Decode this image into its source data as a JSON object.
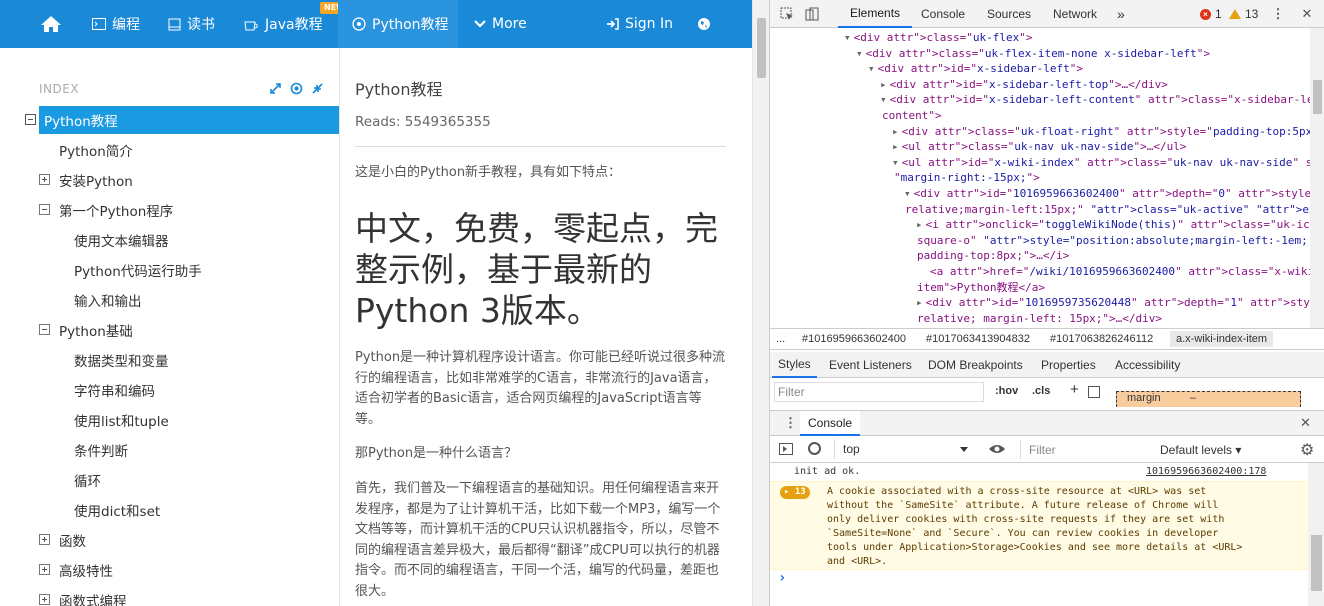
{
  "site": {
    "nav": [
      {
        "label": "",
        "icon": "home-icon"
      },
      {
        "label": "编程",
        "icon": "terminal-icon"
      },
      {
        "label": "读书",
        "icon": "book-icon"
      },
      {
        "label": "Java教程",
        "icon": "coffee-icon",
        "badge": "NEW"
      },
      {
        "label": "Python教程",
        "icon": "python-icon",
        "active": true
      },
      {
        "label": "More",
        "icon": "chevron-down-icon"
      },
      {
        "label": "Sign In",
        "icon": "signin-icon"
      },
      {
        "label": "",
        "icon": "globe-icon"
      }
    ],
    "sidebar": {
      "index_label": "INDEX",
      "items": [
        {
          "label": "Python教程",
          "active": true,
          "toggle": "minus"
        },
        {
          "label": "Python简介",
          "toggle": "none"
        },
        {
          "label": "安装Python",
          "toggle": "plus"
        },
        {
          "label": "第一个Python程序",
          "toggle": "minus"
        },
        {
          "label": "使用文本编辑器",
          "toggle": "none"
        },
        {
          "label": "Python代码运行助手",
          "toggle": "none"
        },
        {
          "label": "输入和输出",
          "toggle": "none"
        },
        {
          "label": "Python基础",
          "toggle": "minus"
        },
        {
          "label": "数据类型和变量",
          "toggle": "none"
        },
        {
          "label": "字符串和编码",
          "toggle": "none"
        },
        {
          "label": "使用list和tuple",
          "toggle": "none"
        },
        {
          "label": "条件判断",
          "toggle": "none"
        },
        {
          "label": "循环",
          "toggle": "none"
        },
        {
          "label": "使用dict和set",
          "toggle": "none"
        },
        {
          "label": "函数",
          "toggle": "plus"
        },
        {
          "label": "高级特性",
          "toggle": "plus"
        },
        {
          "label": "函数式编程",
          "toggle": "plus"
        }
      ]
    },
    "content": {
      "title": "Python教程",
      "reads": "Reads: 5549365355",
      "intro": "这是小白的Python新手教程，具有如下特点：",
      "headline": "中文，免费，零起点，完整示例，基于最新的Python 3版本。",
      "para1": "Python是一种计算机程序设计语言。你可能已经听说过很多种流行的编程语言，比如非常难学的C语言，非常流行的Java语言，适合初学者的Basic语言，适合网页编程的JavaScript语言等等。",
      "para2": "那Python是一种什么语言？",
      "para3": "首先，我们普及一下编程语言的基础知识。用任何编程语言来开发程序，都是为了让计算机干活，比如下载一个MP3，编写一个文档等等，而计算机干活的CPU只认识机器指令，所以，尽管不同的编程语言差异极大，最后都得“翻译”成CPU可以执行的机器指令。而不同的编程语言，干同一个活，编写的代码量，差距也很大。"
    }
  },
  "devtools": {
    "tabs": [
      "Elements",
      "Console",
      "Sources",
      "Network"
    ],
    "more_tabs": "»",
    "error_count": "1",
    "warning_count": "13",
    "elements_lines": [
      {
        "indent": 0,
        "arrow": "▾",
        "html": "<div class=\"uk-flex\">"
      },
      {
        "indent": 1,
        "arrow": "▾",
        "html": "<div class=\"uk-flex-item-none x-sidebar-left\">"
      },
      {
        "indent": 2,
        "arrow": "▾",
        "html": "<div id=\"x-sidebar-left\">"
      },
      {
        "indent": 3,
        "arrow": "▸",
        "html": "<div id=\"x-sidebar-left-top\">…</div>"
      },
      {
        "indent": 3,
        "arrow": "▾",
        "html": "<div id=\"x-sidebar-left-content\" class=\"x-sidebar-left-"
      },
      {
        "indent": 3,
        "arrow": "",
        "html": "content\">"
      },
      {
        "indent": 4,
        "arrow": "▸",
        "html": "<div class=\"uk-float-right\" style=\"padding-top:5px\">…</div>"
      },
      {
        "indent": 4,
        "arrow": "▸",
        "html": "<ul class=\"uk-nav uk-nav-side\">…</ul>"
      },
      {
        "indent": 4,
        "arrow": "▾",
        "html": "<ul id=\"x-wiki-index\" class=\"uk-nav uk-nav-side\" style="
      },
      {
        "indent": 4,
        "arrow": "",
        "html": "\"margin-right:-15px;\">"
      },
      {
        "indent": 5,
        "arrow": "▾",
        "html": "<div id=\"1016959663602400\" depth=\"0\" style=\"position:"
      },
      {
        "indent": 5,
        "arrow": "",
        "html": "relative;margin-left:15px;\" class=\"uk-active\" expand=\"true\">"
      },
      {
        "indent": 6,
        "arrow": "▸",
        "html": "<i onclick=\"toggleWikiNode(this)\" class=\"uk-icon-minus-"
      },
      {
        "indent": 6,
        "arrow": "",
        "html": "square-o\" style=\"position:absolute;margin-left:-1em;"
      },
      {
        "indent": 6,
        "arrow": "",
        "html": "padding-top:8px;\">…</i>"
      },
      {
        "indent": 6,
        "arrow": "",
        "html": "<a href=\"/wiki/1016959663602400\" class=\"x-wiki-index-"
      },
      {
        "indent": 6,
        "arrow": "",
        "html": "item\">Python教程</a>"
      },
      {
        "indent": 6,
        "arrow": "▸",
        "html": "<div id=\"1016959735620448\" depth=\"1\" style=\"position:"
      },
      {
        "indent": 6,
        "arrow": "",
        "html": "relative; margin-left: 15px;\">…</div>"
      }
    ],
    "breadcrumbs": [
      "...",
      "#1016959663602400",
      "#1017063413904832",
      "#1017063826246112",
      "a.x-wiki-index-item"
    ],
    "style_tabs": [
      "Styles",
      "Event Listeners",
      "DOM Breakpoints",
      "Properties",
      "Accessibility"
    ],
    "filter_placeholder": "Filter",
    "hov": ":hov",
    "cls": ".cls",
    "add": "+",
    "box_model_label": "margin",
    "box_model_value": "–",
    "console_tab": "Console",
    "console_context": "top",
    "console_filter": "Filter",
    "log_level": "Default levels",
    "log_line_text": "init ad ok.",
    "log_line_source": "1016959663602400:178",
    "warn_count_badge": "13",
    "warn_text": "A cookie associated with a cross-site resource at <URL> was set\nwithout the `SameSite` attribute. A future release of Chrome will\nonly deliver cookies with cross-site requests if they are set with\n`SameSite=None` and `Secure`. You can review cookies in developer\ntools under Application>Storage>Cookies and see more details at <URL>\nand <URL>.",
    "prompt": "›"
  }
}
